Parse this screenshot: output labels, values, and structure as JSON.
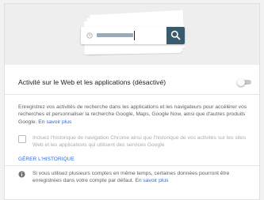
{
  "activity": {
    "title": "Activité sur le Web et les applications (désactivé)",
    "toggle_on": false
  },
  "description": {
    "text": "Enregistrez vos activités de recherche dans les applications et les navigateurs pour accélérer vos recherches et personnaliser la recherche Google, Maps, Google Now, ainsi que d'autres produits Google.",
    "link": "En savoir plus"
  },
  "chrome_history": {
    "label": "Incluez l'historique de navigation Chrome ainsi que l'historique de vos activités sur les sites Web et les applications qui utilisent des services Google",
    "checked": false
  },
  "manage_link": "GÉRER L'HISTORIQUE",
  "info": {
    "text": "Si vous utilisez plusieurs comptes en même temps, certaines données pourront être enregistrées dans votre compte par défaut.",
    "link": "En savoir plus"
  },
  "colors": {
    "link": "#3367d6",
    "search_button": "#3a5a6d",
    "hero_background": "#eeeeee"
  },
  "icons": [
    "clock-icon",
    "search-icon",
    "info-icon"
  ]
}
